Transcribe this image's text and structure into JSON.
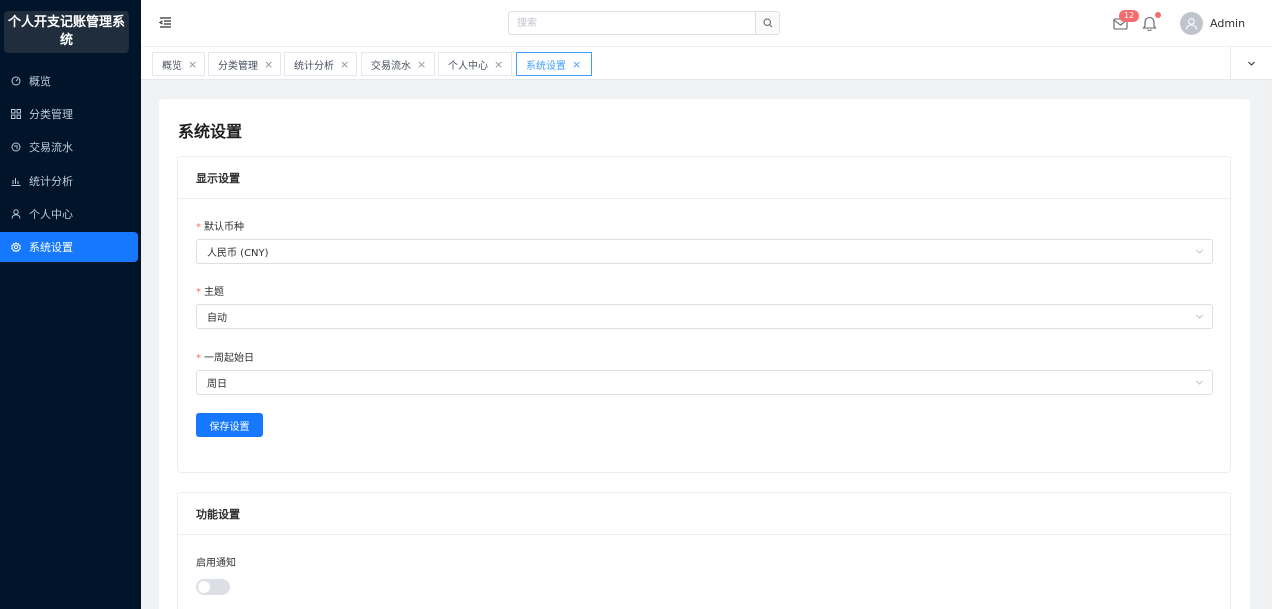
{
  "app": {
    "title": "个人开支记账管理系统"
  },
  "sidebar": {
    "items": [
      {
        "label": "概览",
        "icon": "dashboard-icon",
        "active": false
      },
      {
        "label": "分类管理",
        "icon": "grid-icon",
        "active": false
      },
      {
        "label": "交易流水",
        "icon": "exchange-icon",
        "active": false
      },
      {
        "label": "统计分析",
        "icon": "bar-chart-icon",
        "active": false
      },
      {
        "label": "个人中心",
        "icon": "user-icon",
        "active": false
      },
      {
        "label": "系统设置",
        "icon": "gear-icon",
        "active": true
      }
    ]
  },
  "header": {
    "search_placeholder": "搜索",
    "mail_count": "12",
    "username": "Admin"
  },
  "tabs": [
    {
      "label": "概览",
      "active": false
    },
    {
      "label": "分类管理",
      "active": false
    },
    {
      "label": "统计分析",
      "active": false
    },
    {
      "label": "交易流水",
      "active": false
    },
    {
      "label": "个人中心",
      "active": false
    },
    {
      "label": "系统设置",
      "active": true
    }
  ],
  "page": {
    "title": "系统设置",
    "display_settings": {
      "heading": "显示设置",
      "currency_label": "默认币种",
      "currency_value": "人民币 (CNY)",
      "theme_label": "主题",
      "theme_value": "自动",
      "week_start_label": "一周起始日",
      "week_start_value": "周日",
      "save_label": "保存设置"
    },
    "feature_settings": {
      "heading": "功能设置",
      "notify_label": "启用通知",
      "notify_enabled": false
    }
  },
  "colors": {
    "sidebar_bg": "#001529",
    "accent": "#1677ff",
    "danger": "#f56c6c"
  }
}
